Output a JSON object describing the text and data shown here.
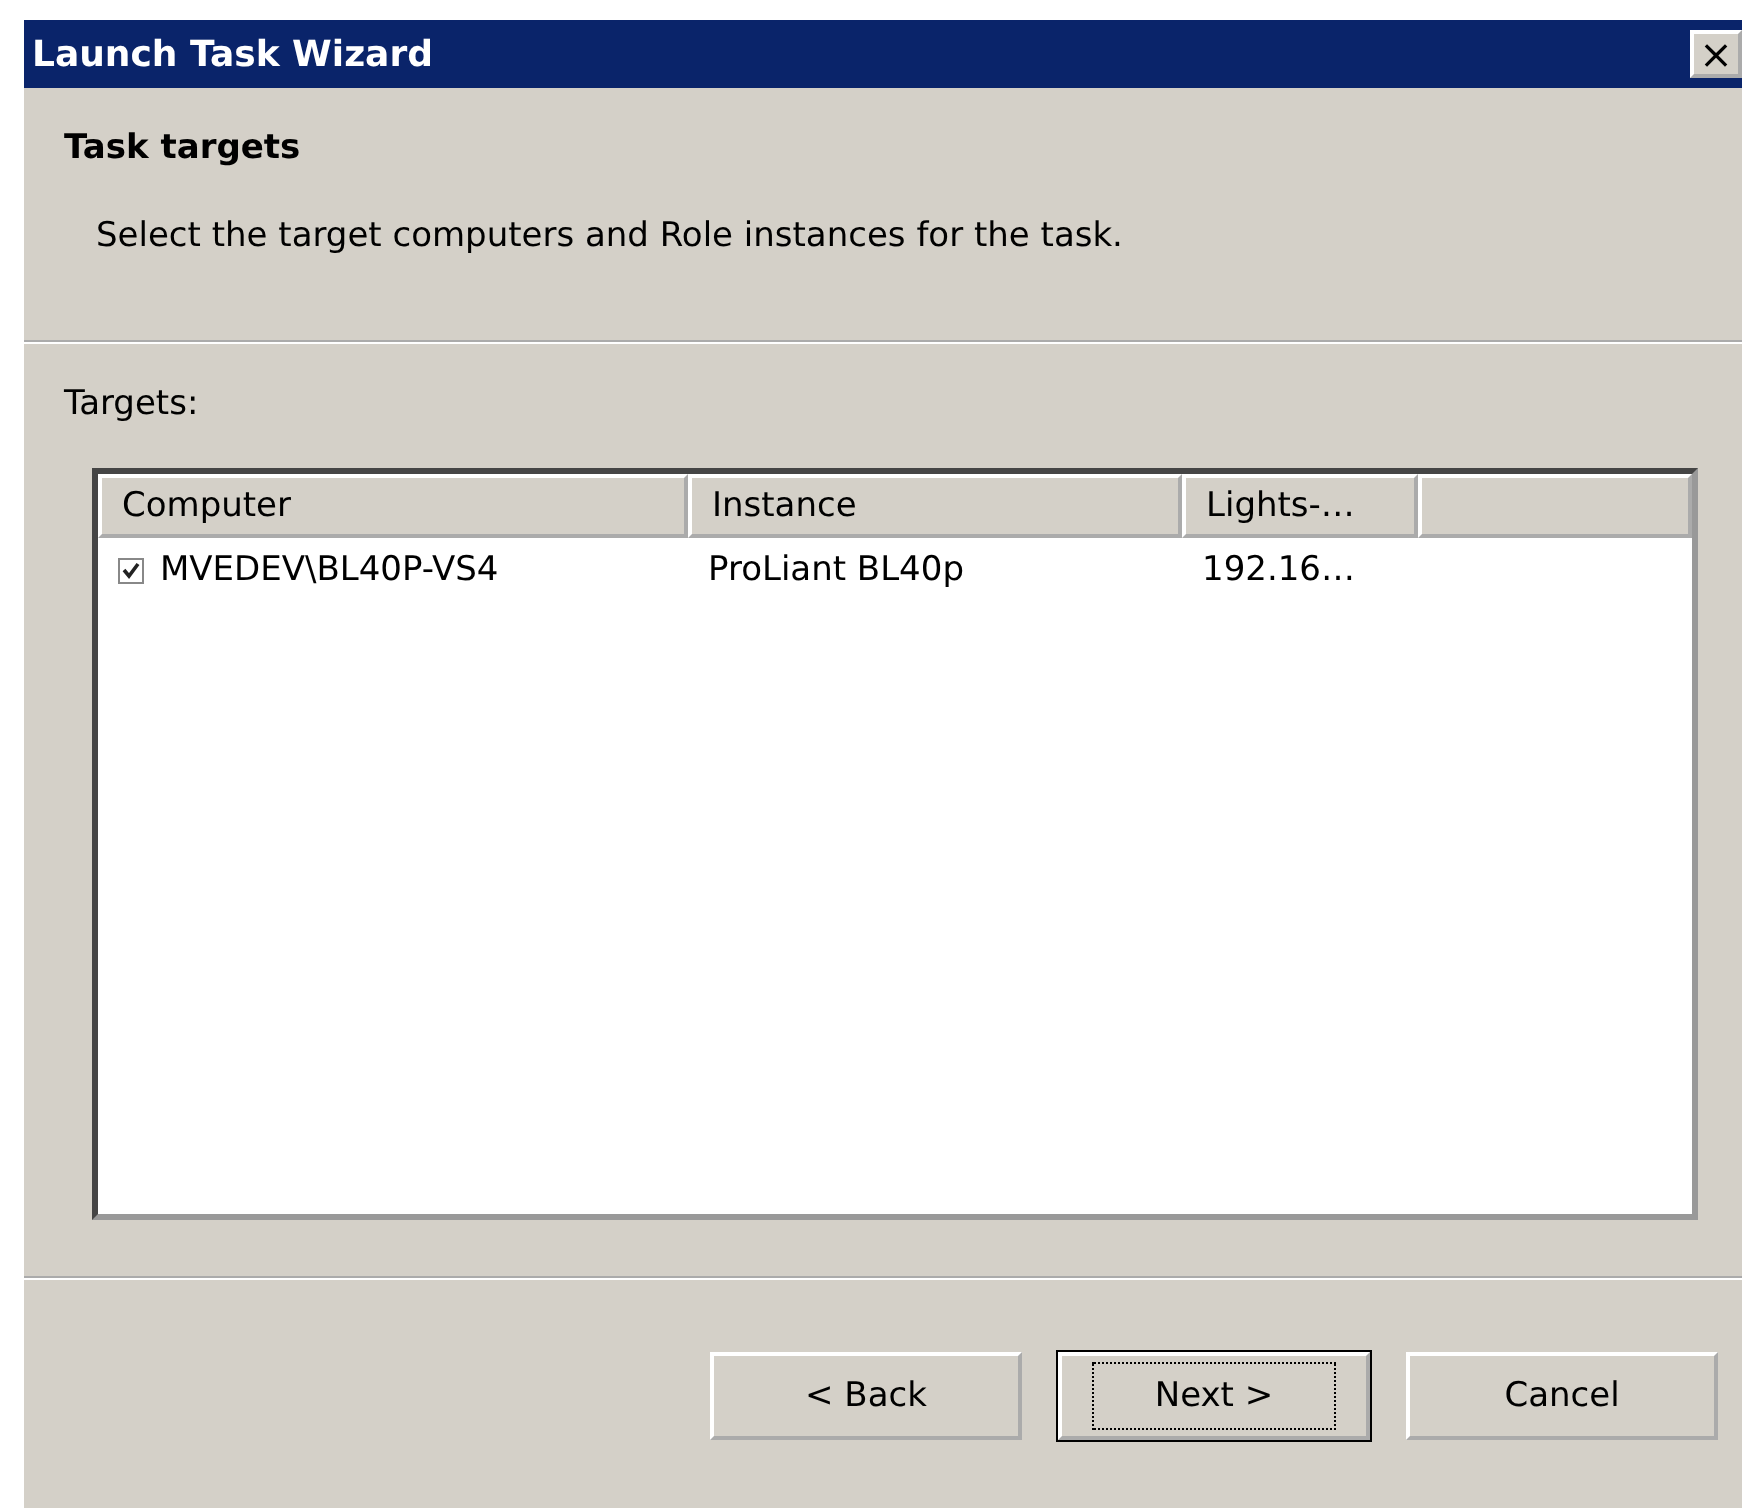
{
  "window": {
    "title": "Launch Task Wizard",
    "close": "×"
  },
  "header": {
    "title": "Task targets",
    "subtitle": "Select the target computers and Role instances for the task."
  },
  "targets": {
    "label": "Targets:",
    "columns": [
      "Computer",
      "Instance",
      "Lights-…"
    ],
    "rows": [
      {
        "checked": true,
        "cells": [
          "MVEDEV\\BL40P-VS4",
          "ProLiant BL40p",
          "192.16…"
        ]
      }
    ]
  },
  "buttons": [
    {
      "label": "< Back",
      "default": false
    },
    {
      "label": "Next >",
      "default": true
    },
    {
      "label": "Cancel",
      "default": false
    }
  ]
}
